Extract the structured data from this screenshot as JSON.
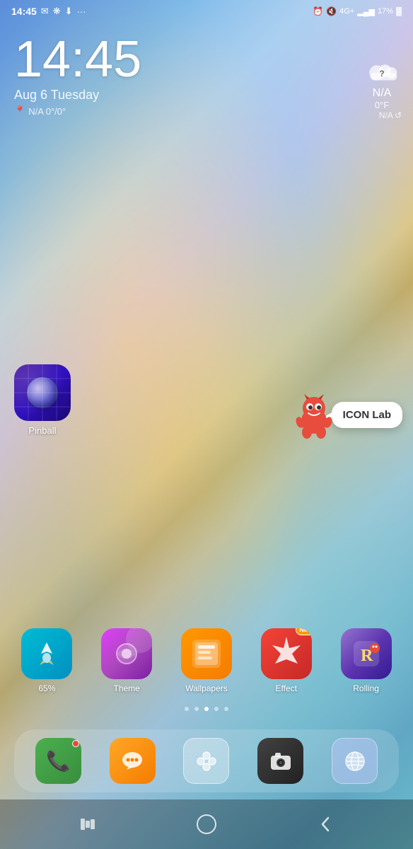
{
  "statusBar": {
    "time": "14:45",
    "leftIcons": [
      "✉",
      "❋",
      "⬇",
      "···"
    ],
    "rightIcons": [
      "⏰",
      "🔕",
      "4G+",
      "📶",
      "17%",
      "🔋"
    ]
  },
  "clock": {
    "time": "14:45",
    "date": "Aug 6  Tuesday",
    "location": "N/A 0°/0°"
  },
  "weather": {
    "icon": "?",
    "status": "N/A",
    "temp": "0°F",
    "location": "N/A",
    "refreshLabel": "↺"
  },
  "pinball": {
    "label": "Pinball"
  },
  "iconLabPopup": {
    "label": "ICON Lab"
  },
  "appRow": {
    "apps": [
      {
        "label": "65%",
        "iconClass": "icon-65"
      },
      {
        "label": "Theme",
        "iconClass": "icon-theme"
      },
      {
        "label": "Wallpapers",
        "iconClass": "icon-wallpapers"
      },
      {
        "label": "Effect",
        "iconClass": "icon-effect",
        "badge": "New"
      },
      {
        "label": "Rolling",
        "iconClass": "icon-rolling"
      }
    ]
  },
  "pageIndicators": {
    "count": 5,
    "active": 2
  },
  "dock": {
    "apps": [
      {
        "name": "phone",
        "iconClass": "dock-phone",
        "hasNotification": true
      },
      {
        "name": "messages",
        "iconClass": "dock-messages",
        "hasNotification": false
      },
      {
        "name": "hub",
        "iconClass": "dock-hub",
        "hasNotification": false
      },
      {
        "name": "camera",
        "iconClass": "dock-camera",
        "hasNotification": false
      },
      {
        "name": "browser",
        "iconClass": "dock-browser",
        "hasNotification": false
      }
    ]
  },
  "navBar": {
    "recents": "|||",
    "home": "○",
    "back": "‹"
  }
}
